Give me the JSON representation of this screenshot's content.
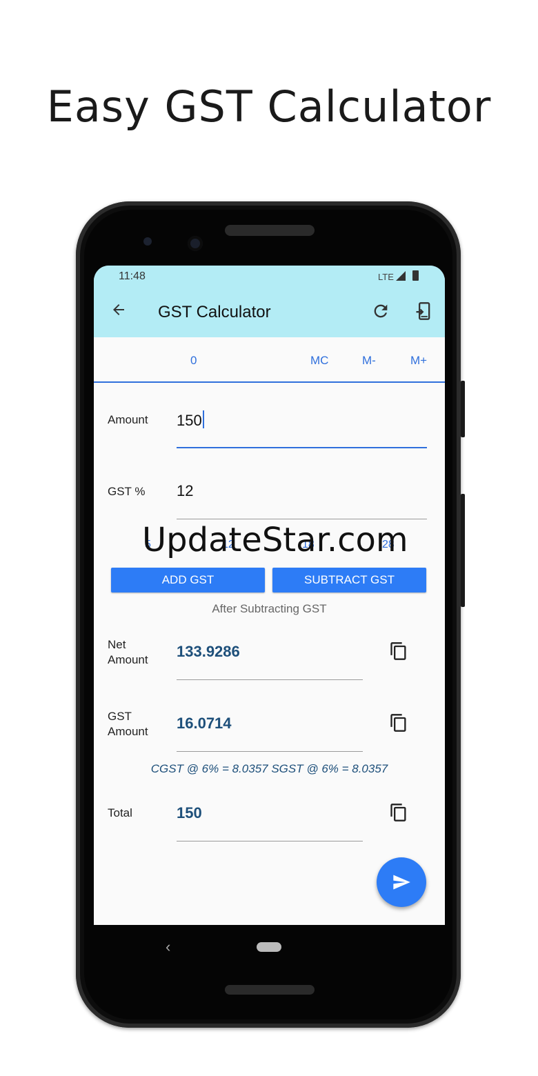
{
  "headline": "Easy GST Calculator",
  "watermark": "UpdateStar.com",
  "status_bar": {
    "time": "11:48",
    "network": "LTE"
  },
  "app_bar": {
    "title": "GST Calculator"
  },
  "memory_bar": {
    "value": "0",
    "buttons": [
      "MC",
      "M-",
      "M+"
    ]
  },
  "amount": {
    "label": "Amount",
    "value": "150"
  },
  "gst_percent": {
    "label": "GST %",
    "value": "12"
  },
  "quick_rates": [
    "5",
    "12",
    "18",
    "28"
  ],
  "actions": {
    "add_label": "ADD GST",
    "subtract_label": "SUBTRACT GST"
  },
  "mode_text": "After Subtracting GST",
  "results": {
    "net": {
      "label_line1": "Net",
      "label_line2": "Amount",
      "value": "133.9286"
    },
    "gst": {
      "label_line1": "GST",
      "label_line2": "Amount",
      "value": "16.0714"
    },
    "split": "CGST @ 6% = 8.0357 SGST @ 6% = 8.0357",
    "total": {
      "label": "Total",
      "value": "150"
    }
  },
  "colors": {
    "app_bar": "#b3ecf5",
    "accent": "#2d7cf6",
    "result_text": "#1d4f7a"
  },
  "icons": [
    "back-arrow-icon",
    "refresh-icon",
    "share-icon",
    "copy-icon",
    "send-icon"
  ]
}
